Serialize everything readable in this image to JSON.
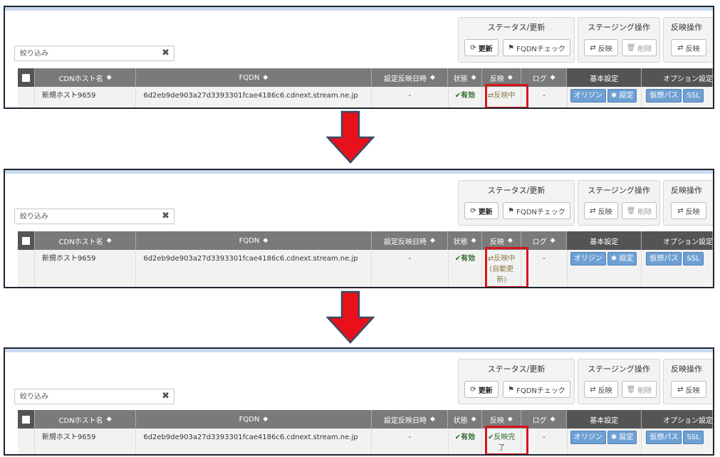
{
  "filter": {
    "placeholder": "絞り込み"
  },
  "groups": {
    "status": {
      "title": "ステータス/更新",
      "refresh": "更新",
      "fqdn_check": "FQDNチェック"
    },
    "staging": {
      "title": "ステージング操作",
      "reflect": "反映",
      "delete": "削除"
    },
    "production": {
      "title": "反映操作",
      "reflect": "反映"
    }
  },
  "columns": [
    "CDNホスト名",
    "FQDN",
    "設定反映日時",
    "状態",
    "反映",
    "ログ",
    "基本設定",
    "オプション設定"
  ],
  "row": {
    "host": "新規ホスト9659",
    "fqdn": "6d2eb9de903a27d3393301fcae4186c6.cdnext.stream.ne.jp",
    "reflected_at": "-",
    "state": "有効",
    "log": "-",
    "basic": [
      "オリジン",
      "設定"
    ],
    "options": [
      "仮想パス",
      "SSL"
    ]
  },
  "steps": [
    {
      "reflect": "反映中"
    },
    {
      "reflect": "反映中\n(自動更\n新)"
    },
    {
      "reflect": "反映完\n了"
    }
  ],
  "colors": {
    "highlight": "#d9141b",
    "arrow": "#e8111b",
    "arrow_border": "#3a4a66",
    "header": "#7a7a7a",
    "chip": "#6fa0d3"
  }
}
